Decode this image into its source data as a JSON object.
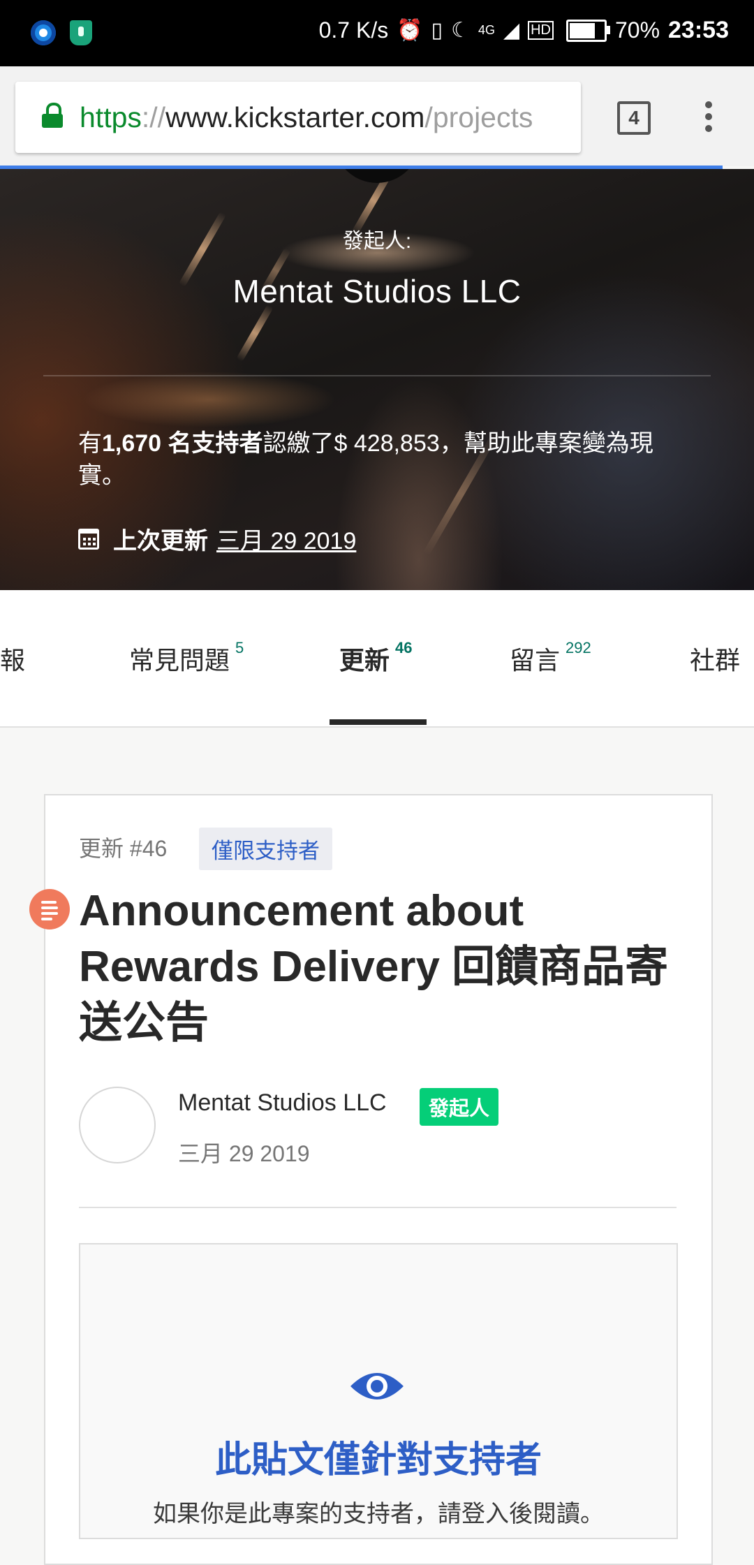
{
  "status_bar": {
    "network_speed": "0.7 K/s",
    "battery": "70%",
    "time": "23:53",
    "icons": [
      "alarm-icon",
      "vibrate-icon",
      "moon-icon",
      "4g-icon",
      "signal-icon",
      "hd-icon",
      "battery-icon"
    ]
  },
  "browser": {
    "url_scheme": "https",
    "url_separator": "://",
    "url_host": "www.kickstarter.com",
    "url_path": "/projects",
    "tab_count": "4"
  },
  "hero": {
    "creator_label": "發起人:",
    "creator_name": "Mentat Studios LLC",
    "backers_prefix": "有",
    "backers_count": "1,670 名支持者",
    "backers_suffix": "認繳了$ 428,853，幫助此專案變為現實。",
    "last_updated_label": "上次更新",
    "last_updated_date": "三月 29 2019"
  },
  "tabs": [
    {
      "label": "回報",
      "count": ""
    },
    {
      "label": "常見問題",
      "count": "5"
    },
    {
      "label": "更新",
      "count": "46"
    },
    {
      "label": "留言",
      "count": "292"
    },
    {
      "label": "社群",
      "count": ""
    }
  ],
  "update": {
    "number": "更新 #46",
    "badge": "僅限支持者",
    "title": "Announcement about Rewards Delivery 回饋商品寄送公告",
    "author_name": "Mentat Studios LLC",
    "author_role": "發起人",
    "date": "三月 29 2019",
    "locked_title": "此貼文僅針對支持者",
    "locked_subtitle": "如果你是此專案的支持者，請登入後閱讀。"
  },
  "colors": {
    "accent_green": "#05ce78",
    "link_blue": "#2d5ec6",
    "post_icon": "#f07a5c",
    "count_green": "#037362"
  }
}
